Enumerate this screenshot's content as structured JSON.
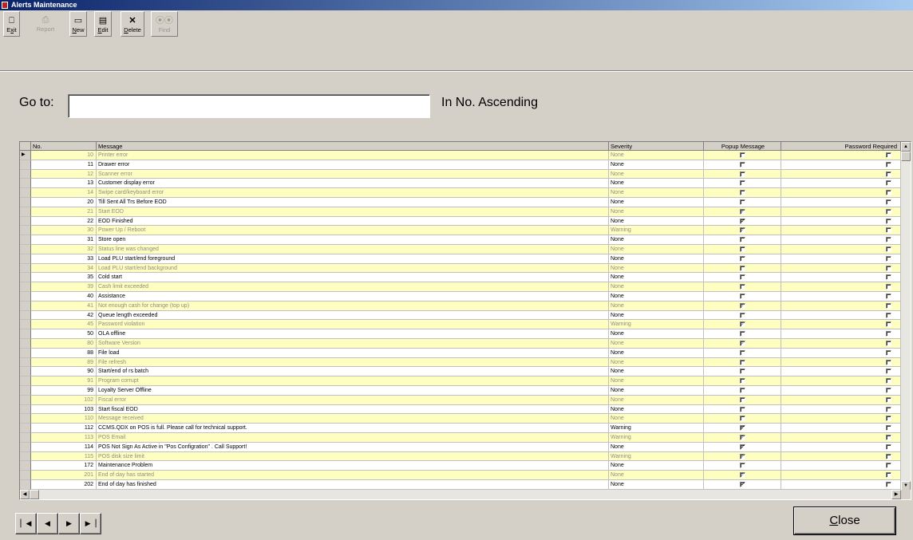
{
  "window": {
    "title": "Alerts Maintenance"
  },
  "toolbar": {
    "exit": {
      "key": "x",
      "rest": "it",
      "first": "E",
      "icon": "exit-icon"
    },
    "report": {
      "label": "Report",
      "icon": "report-icon"
    },
    "new": {
      "first": "N",
      "rest": "ew",
      "icon": "new-icon"
    },
    "edit": {
      "first": "E",
      "rest": "dit",
      "icon": "edit-icon"
    },
    "delete": {
      "first": "D",
      "rest": "elete",
      "icon": "delete-icon"
    },
    "find": {
      "label": "Find",
      "icon": "binoculars-icon"
    }
  },
  "search": {
    "label": "Go to:",
    "value": "",
    "order_label": "In No. Ascending"
  },
  "grid": {
    "columns": [
      "No.",
      "Message",
      "Severity",
      "Popup Message",
      "Password Required"
    ],
    "rows": [
      {
        "no": "10",
        "message": "Printer error",
        "severity": "None",
        "popup": false,
        "password": false
      },
      {
        "no": "11",
        "message": "Drawer error",
        "severity": "None",
        "popup": false,
        "password": false
      },
      {
        "no": "12",
        "message": "Scanner error",
        "severity": "None",
        "popup": false,
        "password": false
      },
      {
        "no": "13",
        "message": "Customer display error",
        "severity": "None",
        "popup": false,
        "password": false
      },
      {
        "no": "14",
        "message": "Swipe card/keyboard error",
        "severity": "None",
        "popup": false,
        "password": false
      },
      {
        "no": "20",
        "message": "Till Sent All Trs Before EOD",
        "severity": "None",
        "popup": false,
        "password": false
      },
      {
        "no": "21",
        "message": "Start EOD",
        "severity": "None",
        "popup": true,
        "password": false
      },
      {
        "no": "22",
        "message": "EOD Finished",
        "severity": "None",
        "popup": true,
        "password": false
      },
      {
        "no": "30",
        "message": "Power Up / Reboot",
        "severity": "Warning",
        "popup": true,
        "password": false
      },
      {
        "no": "31",
        "message": "Store open",
        "severity": "None",
        "popup": false,
        "password": false
      },
      {
        "no": "32",
        "message": "Status line was changed",
        "severity": "None",
        "popup": false,
        "password": false
      },
      {
        "no": "33",
        "message": "Load PLU start/end foreground",
        "severity": "None",
        "popup": false,
        "password": false
      },
      {
        "no": "34",
        "message": "Load PLU start/end background",
        "severity": "None",
        "popup": false,
        "password": false
      },
      {
        "no": "35",
        "message": "Cold start",
        "severity": "None",
        "popup": false,
        "password": false
      },
      {
        "no": "39",
        "message": "Cash limit exceeded",
        "severity": "None",
        "popup": false,
        "password": false
      },
      {
        "no": "40",
        "message": "Assistance",
        "severity": "None",
        "popup": false,
        "password": false
      },
      {
        "no": "41",
        "message": "Not enough cash for change (top up)",
        "severity": "None",
        "popup": true,
        "password": false
      },
      {
        "no": "42",
        "message": "Queue length exceeded",
        "severity": "None",
        "popup": false,
        "password": false
      },
      {
        "no": "45",
        "message": "Password violation",
        "severity": "Warning",
        "popup": true,
        "password": false
      },
      {
        "no": "50",
        "message": "OLA offline",
        "severity": "None",
        "popup": false,
        "password": false
      },
      {
        "no": "80",
        "message": "Software Version",
        "severity": "None",
        "popup": true,
        "password": false
      },
      {
        "no": "88",
        "message": "File load",
        "severity": "None",
        "popup": false,
        "password": false
      },
      {
        "no": "89",
        "message": "File refresh",
        "severity": "None",
        "popup": false,
        "password": false
      },
      {
        "no": "90",
        "message": "Start/end of rs batch",
        "severity": "None",
        "popup": false,
        "password": false
      },
      {
        "no": "91",
        "message": "Program corrupt",
        "severity": "None",
        "popup": false,
        "password": false
      },
      {
        "no": "99",
        "message": "Loyalty Server Offline",
        "severity": "None",
        "popup": false,
        "password": false
      },
      {
        "no": "102",
        "message": "Fiscal error",
        "severity": "None",
        "popup": false,
        "password": false
      },
      {
        "no": "103",
        "message": "Start fiscal EOD",
        "severity": "None",
        "popup": false,
        "password": false
      },
      {
        "no": "110",
        "message": "Message received",
        "severity": "None",
        "popup": false,
        "password": false
      },
      {
        "no": "112",
        "message": "CCMS.QDX on POS is full. Please call for technical support.",
        "severity": "Warning",
        "popup": true,
        "password": false
      },
      {
        "no": "113",
        "message": "POS Email",
        "severity": "Warning",
        "popup": true,
        "password": false
      },
      {
        "no": "114",
        "message": "POS Not Sign As Active in \"Pos Configration\" . Call Support!",
        "severity": "None",
        "popup": true,
        "password": false
      },
      {
        "no": "115",
        "message": "POS disk size limit",
        "severity": "Warning",
        "popup": true,
        "password": false
      },
      {
        "no": "172",
        "message": "Maintenance Problem",
        "severity": "None",
        "popup": false,
        "password": false
      },
      {
        "no": "201",
        "message": "End of day has started",
        "severity": "None",
        "popup": true,
        "password": false
      },
      {
        "no": "202",
        "message": "End of day has finished",
        "severity": "None",
        "popup": true,
        "password": false
      }
    ]
  },
  "nav": {
    "first": "first-record-icon",
    "prev": "previous-record-icon",
    "next": "next-record-icon",
    "last": "last-record-icon"
  },
  "close_button": {
    "first": "C",
    "rest": "lose"
  }
}
